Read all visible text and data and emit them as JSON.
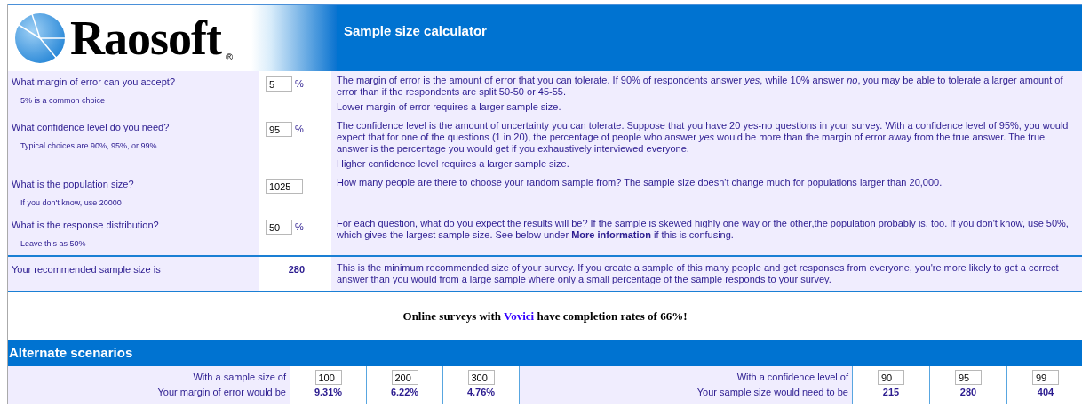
{
  "header": {
    "logo_text": "Raosoft",
    "logo_mark": "®",
    "title": "Sample size calculator"
  },
  "questions": [
    {
      "question": "What margin of error can you accept?",
      "hint": "5% is a common choice",
      "value": "5",
      "unit": "%",
      "description": [
        "The margin of error is the amount of error that you can tolerate. If 90% of respondents answer *yes*, while 10% answer *no*, you may be able to tolerate a larger amount of error than if the respondents are split 50-50 or 45-55.",
        "Lower margin of error requires a larger sample size."
      ]
    },
    {
      "question": "What confidence level do you need?",
      "hint": "Typical choices are 90%, 95%, or 99%",
      "value": "95",
      "unit": "%",
      "description": [
        "The confidence level is the amount of uncertainty you can tolerate. Suppose that you have 20 yes-no questions in your survey. With a confidence level of 95%, you would expect that for one of the questions (1 in 20), the percentage of people who answer *yes* would be more than the margin of error away from the true answer. The true answer is the percentage you would get if you exhaustively interviewed everyone.",
        "Higher confidence level requires a larger sample size."
      ]
    },
    {
      "question": "What is the population size?",
      "hint": "If you don't know, use 20000",
      "value": "1025",
      "description": [
        "How many people are there to choose your random sample from? The sample size doesn't change much for populations larger than 20,000."
      ]
    },
    {
      "question": "What is the response distribution?",
      "hint": "Leave this as 50%",
      "value": "50",
      "unit": "%",
      "description": [
        "For each question, what do you expect the results will be? If the sample is skewed highly one way or the other,the population probably is, too. If you don't know, use 50%, which gives the largest sample size. See below under **More information** if this is confusing."
      ]
    }
  ],
  "result": {
    "label": "Your recommended sample size is",
    "value": "280",
    "description": "This is the minimum recommended size of your survey. If you create a sample of this many people and get responses from everyone, you're more likely to get a correct answer than you would from a large sample where only a small percentage of the sample responds to your survey."
  },
  "promo": {
    "before": "Online surveys with",
    "link": "Vovici",
    "after": "have completion rates of 66%!"
  },
  "alternate": {
    "title": "Alternate scenarios",
    "left": {
      "input_label": "With a sample size of",
      "inputs": [
        "100",
        "200",
        "300"
      ],
      "output_label": "Your margin of error would be",
      "outputs": [
        "9.31%",
        "6.22%",
        "4.76%"
      ]
    },
    "right": {
      "input_label": "With a confidence level of",
      "inputs": [
        "90",
        "95",
        "99"
      ],
      "output_label": "Your sample size would need to be",
      "outputs": [
        "215",
        "280",
        "404"
      ]
    }
  }
}
